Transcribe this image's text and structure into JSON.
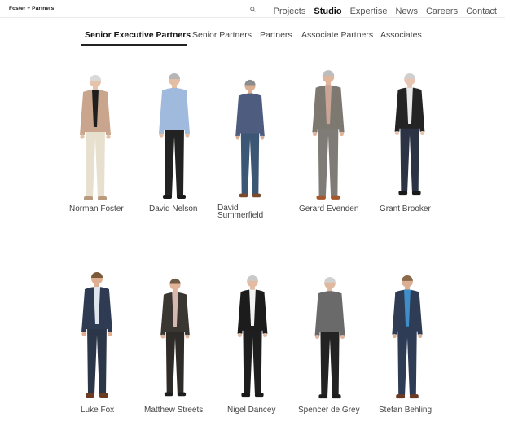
{
  "header": {
    "logo": "Foster + Partners",
    "nav": [
      {
        "label": "Projects",
        "active": false
      },
      {
        "label": "Studio",
        "active": true
      },
      {
        "label": "Expertise",
        "active": false
      },
      {
        "label": "News",
        "active": false
      },
      {
        "label": "Careers",
        "active": false
      },
      {
        "label": "Contact",
        "active": false
      }
    ]
  },
  "tabs": [
    {
      "label": "Senior Executive Partners",
      "active": true
    },
    {
      "label": "Senior Partners",
      "active": false
    },
    {
      "label": "Partners",
      "active": false
    },
    {
      "label": "Associate Partners",
      "active": false
    },
    {
      "label": "Associates",
      "active": false
    }
  ],
  "people": [
    {
      "name": "Norman Foster",
      "jacket": "#c8a58c",
      "shirt": "#1e1e1e",
      "trousers": "#e8e0cf",
      "shoes": "#b99a7e",
      "skin": "#e6c2aa",
      "hair": "#d9d9d9"
    },
    {
      "name": "David Nelson",
      "jacket": "#9fbadc",
      "shirt": "#9fbadc",
      "trousers": "#222222",
      "shoes": "#1a1a1a",
      "skin": "#e3bda4",
      "hair": "#b5b5b5"
    },
    {
      "name": "David Summerfield",
      "jacket": "#4e5c80",
      "shirt": "#4e5c80",
      "trousers": "#3c5775",
      "shoes": "#7a4a2c",
      "skin": "#dcae92",
      "hair": "#8c8c8c"
    },
    {
      "name": "Gerard Evenden",
      "jacket": "#7d7870",
      "shirt": "#caa596",
      "trousers": "#7f7b76",
      "shoes": "#a5582d",
      "skin": "#e1b59b",
      "hair": "#bdbdbd"
    },
    {
      "name": "Grant Brooker",
      "jacket": "#242424",
      "shirt": "#e9e9e9",
      "trousers": "#2b3345",
      "shoes": "#1a1a1a",
      "skin": "#e8c5b0",
      "hair": "#cfcfcf"
    },
    {
      "name": "Luke Fox",
      "jacket": "#2f3b52",
      "shirt": "#dfe6ee",
      "trousers": "#2b3648",
      "shoes": "#6b3a22",
      "skin": "#dfae90",
      "hair": "#7a5a3a"
    },
    {
      "name": "Matthew Streets",
      "jacket": "#3a3632",
      "shirt": "#d6b8b0",
      "trousers": "#2e2b29",
      "shoes": "#1e1e1e",
      "skin": "#e1b49a",
      "hair": "#6e5a45"
    },
    {
      "name": "Nigel Dancey",
      "jacket": "#1c1c1c",
      "shirt": "#f2f2f2",
      "trousers": "#1e1e1e",
      "shoes": "#1a1a1a",
      "skin": "#e3bba2",
      "hair": "#c9c9c9"
    },
    {
      "name": "Spencer de Grey",
      "jacket": "#6a6a6a",
      "shirt": "#6a6a6a",
      "trousers": "#232323",
      "shoes": "#1e1e1e",
      "skin": "#e0b8a0",
      "hair": "#d0d0d0"
    },
    {
      "name": "Stefan Behling",
      "jacket": "#2e3d55",
      "shirt": "#3f8ec9",
      "trousers": "#2e3d55",
      "shoes": "#6b3a22",
      "skin": "#dcae92",
      "hair": "#8a6a4a"
    }
  ]
}
